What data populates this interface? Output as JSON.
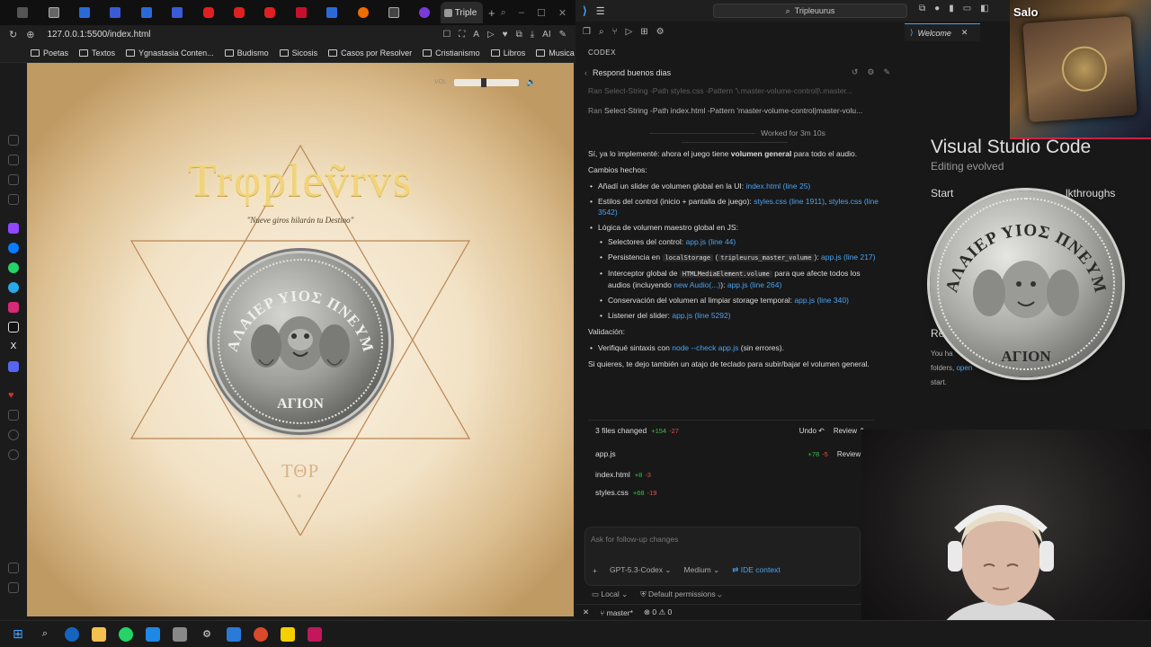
{
  "browser": {
    "active_tab": "Triple",
    "url": "127.0.0.1:5500/index.html",
    "bookmarks": [
      "Poetas",
      "Textos",
      "Ygnastasia Conten...",
      "Budismo",
      "Sicosis",
      "Casos por Resolver",
      "Cristianismo",
      "Libros",
      "Musica"
    ],
    "page": {
      "volume_label": "VOL",
      "volume_level": 0.45,
      "title": "Trφpleṽrvs",
      "motto": "\"Nueve giros hilarán tu Destino\"",
      "coin_top_text": "ΠΑΛΑΙΕΡ ΥΙΟΣ ΠΝΕΥΜΑ",
      "coin_bottom_text": "ΑΓΙΟΝ",
      "bottom_text": "ΤΘΡ"
    }
  },
  "vscode": {
    "search": "Tripleuurus",
    "panel_header": "CODEX",
    "thread_title": "Respond buenos dias",
    "cmd1": "Ran Select-String -Path styles.css -Pattern '\\.master-volume-control|\\.master...",
    "cmd2_prefix": "Ran",
    "cmd2": "Select-String -Path index.html -Pattern 'master-volume-control|master-volu...",
    "worked": "Worked for 3m 10s",
    "msg": {
      "intro_a": "Sí, ya lo implementé: ahora el juego tiene",
      "intro_b": "volumen general",
      "intro_c": "para todo el audio.",
      "changes_head": "Cambios hechos:",
      "b1_a": "Añadí un slider de volumen global en la UI:",
      "b1_link": "index.html (line 25)",
      "b2_a": "Estilos del control (inicio + pantalla de juego):",
      "b2_link1": "styles.css (line 1911)",
      "b2_link2": "styles.css (line 3542)",
      "b3_a": "Lógica de volumen maestro global en JS:",
      "s1_a": "Selectores del control:",
      "s1_link": "app.js (line 44)",
      "s2_a": "Persistencia en",
      "s2_code1": "localStorage",
      "s2_code2": "tripleurus_master_volume",
      "s2_link": "app.js (line 217)",
      "s3_a": "Interceptor global de",
      "s3_code": "HTMLMediaElement.volume",
      "s3_b": "para que afecte todos los audios (incluyendo",
      "s3_link1": "new Audio(...)",
      "s3_link2": "app.js (line 264)",
      "s4_a": "Conservación del volumen al limpiar storage temporal:",
      "s4_link": "app.js (line 340)",
      "s5_a": "Listener del slider:",
      "s5_link": "app.js (line 5292)",
      "validation_head": "Validación:",
      "v1_a": "Verifiqué sintaxis con",
      "v1_link": "node --check app.js",
      "v1_b": "(sin errores).",
      "outro": "Si quieres, te dejo también un atajo de teclado para subir/bajar el volumen general."
    },
    "changes": {
      "summary": "3 files changed",
      "add": "+154",
      "del": "-27",
      "undo": "Undo",
      "review": "Review",
      "files": [
        {
          "name": "app.js",
          "add": "+78",
          "del": "-5",
          "review": "Review"
        },
        {
          "name": "index.html",
          "add": "+8",
          "del": "-3"
        },
        {
          "name": "styles.css",
          "add": "+68",
          "del": "-19"
        }
      ]
    },
    "input": {
      "placeholder": "Ask for follow-up changes",
      "model": "GPT-5.3-Codex",
      "effort": "Medium",
      "ide_context": "IDE context",
      "local": "Local",
      "permissions": "Default permissions"
    },
    "status": {
      "branch": "master*",
      "problems": "⊗ 0 ⚠ 0"
    },
    "editor_tab": "Welcome",
    "welcome": {
      "title": "Visual Studio Code",
      "subtitle": "Editing evolved",
      "start": "Start",
      "walkthroughs": "lkthroughs",
      "recent": "Re",
      "recent_txt_a": "You ha",
      "recent_txt_b": "folders,",
      "recent_txt_link": "open",
      "recent_txt_c": "start."
    }
  },
  "overlay": {
    "badge": "Salo"
  },
  "colors": {
    "accent": "#3ea6ff",
    "link": "#4ba3f0",
    "add": "#3fb950",
    "del": "#d9534f",
    "gold": "#f1d47a"
  }
}
